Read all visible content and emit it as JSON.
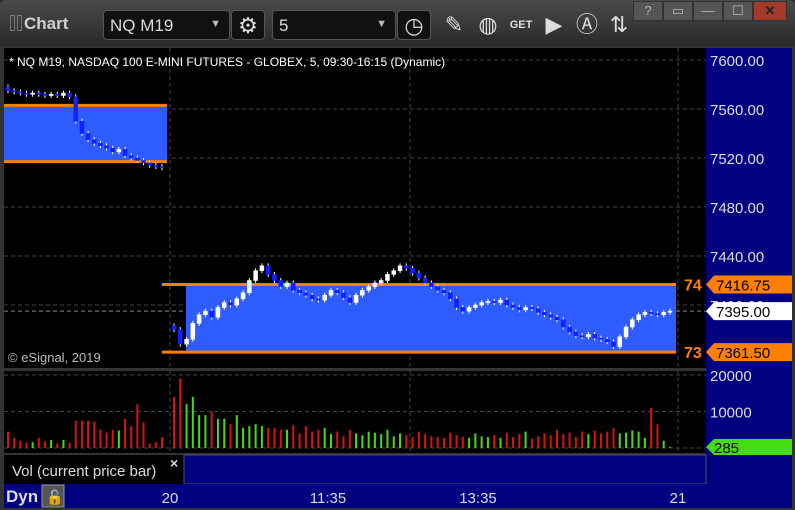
{
  "window": {
    "title": "Chart",
    "symbol": "NQ M19",
    "interval": "5",
    "help": "?",
    "close": "✕"
  },
  "chart": {
    "description": "* NQ M19, NASDAQ 100 E-MINI FUTURES - GLOBEX, 5, 09:30-16:15 (Dynamic)",
    "copyright": "© eSignal, 2019",
    "price_axis": [
      "7600.00",
      "7560.00",
      "7520.00",
      "7480.00",
      "7440.00",
      "7400.00"
    ],
    "price_ticks": [
      7600,
      7560,
      7520,
      7480,
      7440,
      7400
    ],
    "last_price": "7395.00",
    "last_value": 7395,
    "upper_level": {
      "label": "74",
      "price": "7416.75",
      "value": 7416.75
    },
    "lower_level": {
      "label": "73",
      "price": "7361.50",
      "value": 7361.5
    },
    "prior_band": {
      "high": 7563,
      "low": 7517
    },
    "prior_closes": [
      7575,
      7574,
      7573,
      7572,
      7573,
      7572,
      7571,
      7572,
      7571,
      7573,
      7570,
      7550,
      7540,
      7535,
      7532,
      7530,
      7528,
      7525,
      7527,
      7522,
      7520,
      7518,
      7516,
      7514,
      7513,
      7512
    ],
    "prior_volumes": [
      4500,
      2800,
      2000,
      1500,
      1600,
      2800,
      1800,
      2200,
      1200,
      2200,
      1500,
      7500,
      7500,
      7500,
      7200,
      5000,
      4200,
      5000,
      4800,
      8000,
      6000,
      12000,
      7000,
      1200,
      1600,
      3000
    ],
    "closes": [
      7380,
      7368,
      7372,
      7385,
      7392,
      7395,
      7390,
      7398,
      7402,
      7400,
      7405,
      7410,
      7420,
      7428,
      7432,
      7425,
      7420,
      7415,
      7418,
      7412,
      7410,
      7408,
      7405,
      7404,
      7408,
      7412,
      7410,
      7406,
      7402,
      7408,
      7412,
      7415,
      7418,
      7420,
      7425,
      7428,
      7432,
      7430,
      7426,
      7422,
      7418,
      7415,
      7412,
      7410,
      7405,
      7398,
      7395,
      7398,
      7400,
      7402,
      7403,
      7402,
      7404,
      7400,
      7398,
      7396,
      7398,
      7397,
      7394,
      7392,
      7390,
      7388,
      7382,
      7378,
      7375,
      7374,
      7376,
      7373,
      7372,
      7370,
      7366,
      7374,
      7382,
      7388,
      7392,
      7394,
      7393,
      7392,
      7394,
      7395
    ],
    "volumes": [
      14000,
      19000,
      12000,
      14000,
      9000,
      9000,
      10000,
      8000,
      8000,
      6500,
      9000,
      5500,
      6000,
      6500,
      6000,
      5500,
      5500,
      5000,
      5000,
      6200,
      4000,
      6000,
      4500,
      5000,
      5500,
      3800,
      4500,
      3200,
      5000,
      4000,
      3500,
      4500,
      4200,
      3800,
      5000,
      3200,
      4000,
      3500,
      3000,
      4500,
      3800,
      3200,
      3000,
      2800,
      4200,
      3500,
      3000,
      2800,
      4000,
      3200,
      3000,
      3500,
      2800,
      4200,
      3000,
      3800,
      4500,
      2500,
      3200,
      4000,
      3500,
      5000,
      3800,
      4200,
      3000,
      4500,
      3800,
      4800,
      4000,
      4500,
      5500,
      4000,
      4200,
      4800,
      4500,
      2800,
      11000,
      6500,
      2000,
      285
    ],
    "volume_axis": [
      "20000",
      "10000"
    ],
    "volume_ticks": [
      20000,
      10000
    ],
    "last_volume": "285",
    "study_label": "Vol (current price bar)",
    "study_close": "×",
    "time_axis": [
      "20",
      "11:35",
      "13:35",
      "21"
    ],
    "mode": "Dyn",
    "colors": {
      "band": "#2f5cff",
      "level": "#ff8000",
      "axis_bg": "#000080",
      "up_vol": "#44dd11",
      "down_vol": "#dd1111",
      "down_candle": "#1020ff"
    }
  }
}
